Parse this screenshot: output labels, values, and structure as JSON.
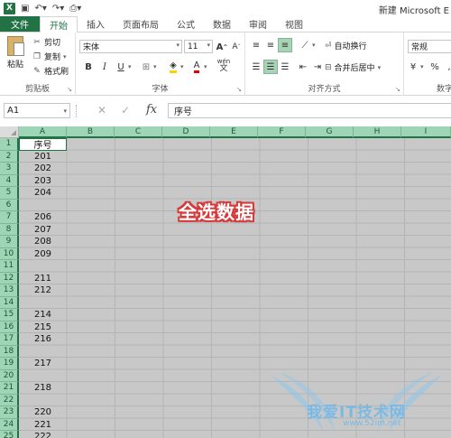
{
  "title_bar": {
    "app_icon": "X",
    "doc_title": "新建 Microsoft E"
  },
  "tabs": [
    {
      "label": "文件"
    },
    {
      "label": "开始"
    },
    {
      "label": "插入"
    },
    {
      "label": "页面布局"
    },
    {
      "label": "公式"
    },
    {
      "label": "数据"
    },
    {
      "label": "审阅"
    },
    {
      "label": "视图"
    }
  ],
  "ribbon": {
    "clipboard": {
      "paste": "粘贴",
      "cut": "剪切",
      "copy": "复制",
      "format_painter": "格式刷",
      "group_label": "剪贴板"
    },
    "font": {
      "font_name": "宋体",
      "font_size": "11",
      "bold": "B",
      "italic": "I",
      "underline": "U",
      "grow": "A",
      "shrink": "A",
      "wen": "wén",
      "group_label": "字体"
    },
    "alignment": {
      "wrap_text": "自动换行",
      "merge_center": "合并后居中",
      "group_label": "对齐方式"
    },
    "number": {
      "format": "常规",
      "percent": "%",
      "group_label": "数字"
    }
  },
  "formula_bar": {
    "name_box": "A1",
    "content": "序号"
  },
  "grid": {
    "columns": [
      "A",
      "B",
      "C",
      "D",
      "E",
      "F",
      "G",
      "H",
      "I"
    ],
    "rows": [
      "1",
      "2",
      "3",
      "4",
      "5",
      "6",
      "7",
      "8",
      "9",
      "10",
      "11",
      "12",
      "13",
      "14",
      "15",
      "16",
      "17",
      "18",
      "19",
      "20",
      "21",
      "22",
      "23",
      "24",
      "25"
    ],
    "col_a_values": [
      "序号",
      "201",
      "202",
      "203",
      "204",
      "",
      "206",
      "207",
      "208",
      "209",
      "",
      "211",
      "212",
      "",
      "214",
      "215",
      "216",
      "",
      "217",
      "",
      "218",
      "",
      "220",
      "221",
      "222"
    ]
  },
  "overlay_caption": "全选数据",
  "watermark": {
    "text": "我爱IT技术网",
    "url": "www.52im.net"
  },
  "colors": {
    "excel_green": "#217346",
    "header_highlight": "#9fd5b7",
    "selection_fill": "#c8c8c8",
    "caption_outline": "#d63a3a"
  }
}
